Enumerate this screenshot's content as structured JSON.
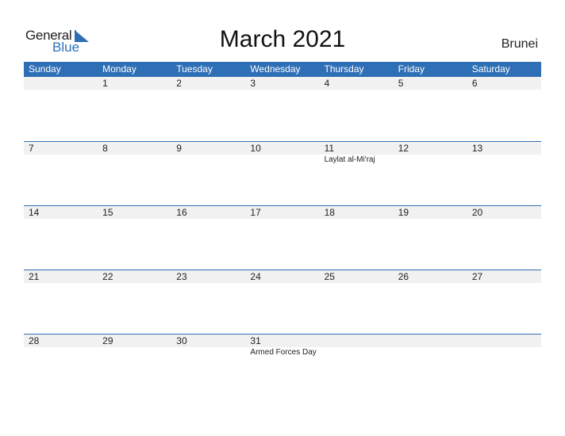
{
  "logo": {
    "line1": "General",
    "line2": "Blue"
  },
  "title": "March 2021",
  "country": "Brunei",
  "colors": {
    "accent": "#2E6FB5",
    "band": "#f1f1f1"
  },
  "weekdays": [
    "Sunday",
    "Monday",
    "Tuesday",
    "Wednesday",
    "Thursday",
    "Friday",
    "Saturday"
  ],
  "weeks": [
    [
      {
        "day": ""
      },
      {
        "day": "1"
      },
      {
        "day": "2"
      },
      {
        "day": "3"
      },
      {
        "day": "4"
      },
      {
        "day": "5"
      },
      {
        "day": "6"
      }
    ],
    [
      {
        "day": "7"
      },
      {
        "day": "8"
      },
      {
        "day": "9"
      },
      {
        "day": "10"
      },
      {
        "day": "11",
        "event": "Laylat al-Mi'raj"
      },
      {
        "day": "12"
      },
      {
        "day": "13"
      }
    ],
    [
      {
        "day": "14"
      },
      {
        "day": "15"
      },
      {
        "day": "16"
      },
      {
        "day": "17"
      },
      {
        "day": "18"
      },
      {
        "day": "19"
      },
      {
        "day": "20"
      }
    ],
    [
      {
        "day": "21"
      },
      {
        "day": "22"
      },
      {
        "day": "23"
      },
      {
        "day": "24"
      },
      {
        "day": "25"
      },
      {
        "day": "26"
      },
      {
        "day": "27"
      }
    ],
    [
      {
        "day": "28"
      },
      {
        "day": "29"
      },
      {
        "day": "30"
      },
      {
        "day": "31",
        "event": "Armed Forces Day"
      },
      {
        "day": ""
      },
      {
        "day": ""
      },
      {
        "day": ""
      }
    ]
  ]
}
